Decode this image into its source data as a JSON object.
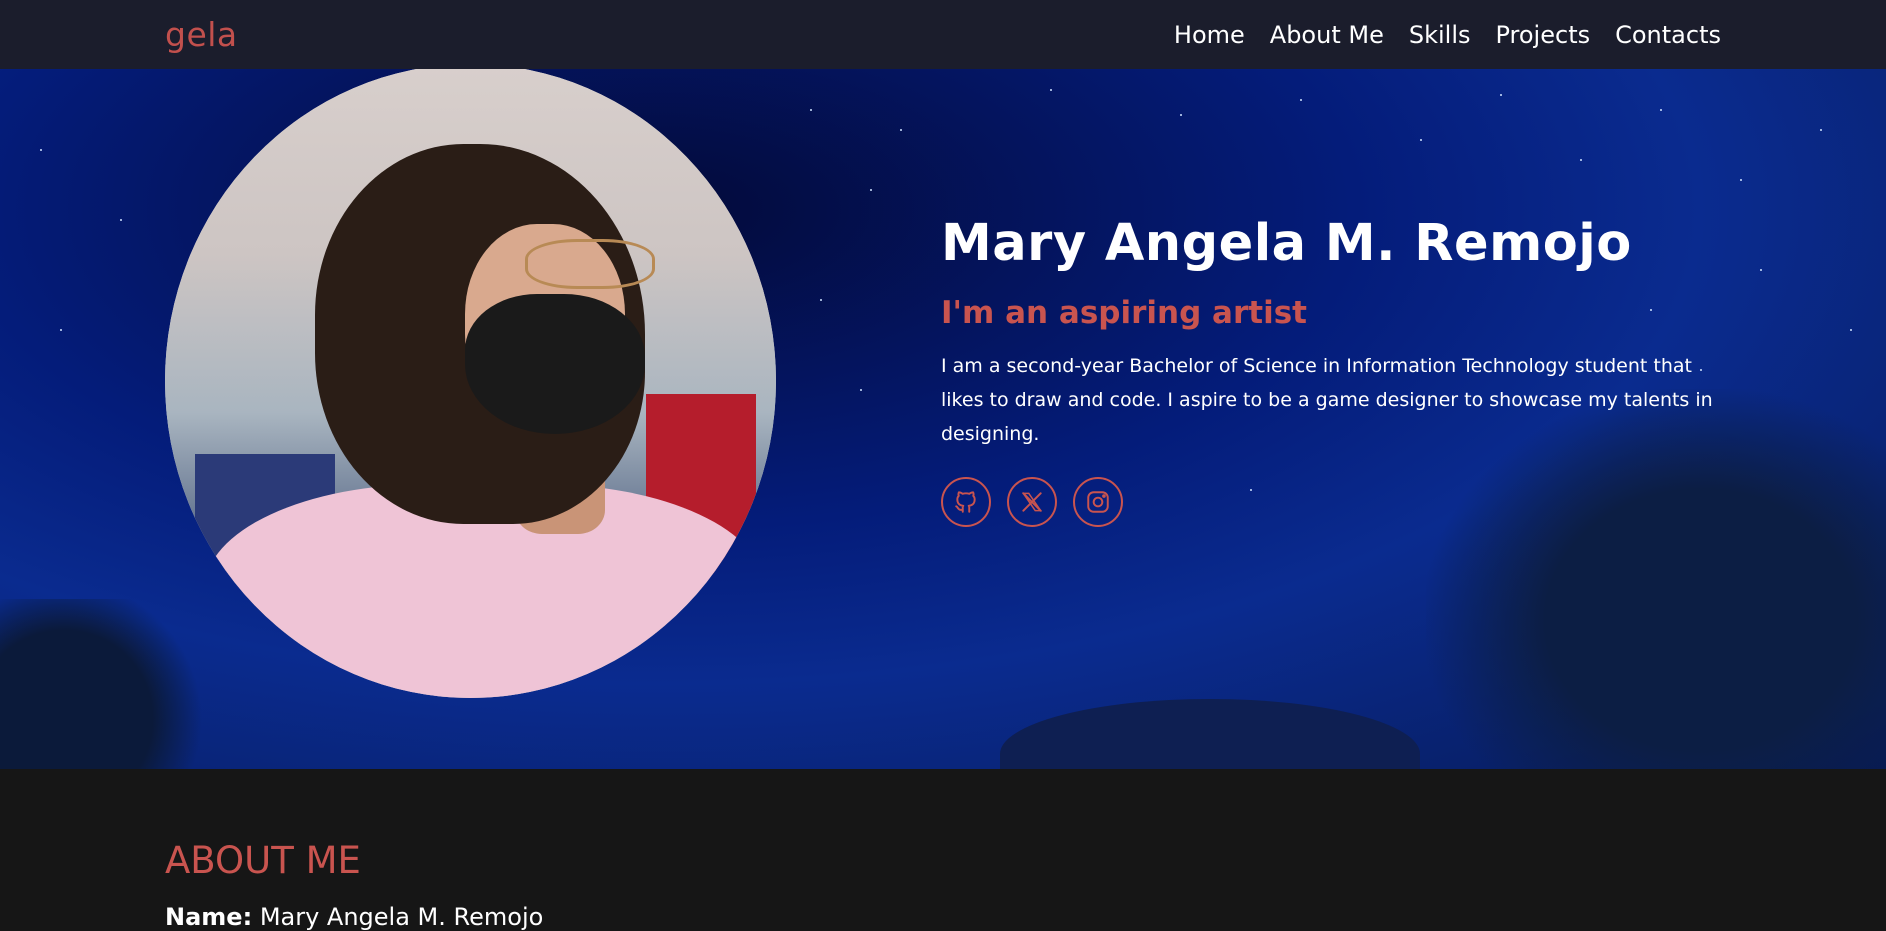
{
  "brand": "gela",
  "nav": [
    {
      "label": "Home"
    },
    {
      "label": "About Me"
    },
    {
      "label": "Skills"
    },
    {
      "label": "Projects"
    },
    {
      "label": "Contacts"
    }
  ],
  "hero": {
    "name": "Mary Angela M. Remojo",
    "tagline": "I'm an aspiring artist",
    "description": "I am a second-year Bachelor of Science in Information Technology student that likes to draw and code. I aspire to be a game designer to showcase my talents in designing.",
    "socials": [
      {
        "icon": "github-icon"
      },
      {
        "icon": "x-twitter-icon"
      },
      {
        "icon": "instagram-icon"
      }
    ]
  },
  "about": {
    "title": "ABOUT ME",
    "name_label": "Name:",
    "name_value": "Mary Angela M. Remojo"
  },
  "colors": {
    "accent": "#c9544f",
    "navbar": "#1b1d2c",
    "page_bg": "#161616"
  }
}
